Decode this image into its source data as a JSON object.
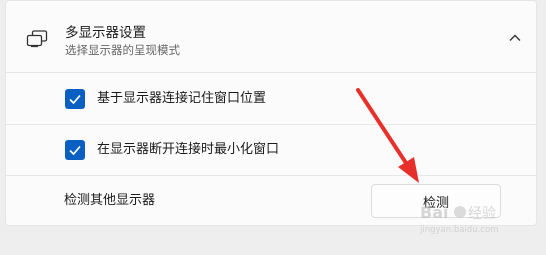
{
  "section": {
    "title": "多显示器设置",
    "subtitle": "选择显示器的呈现模式",
    "icon": "multi-monitor-icon",
    "expand_icon": "chevron-up-icon"
  },
  "options": [
    {
      "label": "基于显示器连接记住窗口位置",
      "checked": true
    },
    {
      "label": "在显示器断开连接时最小化窗口",
      "checked": true
    }
  ],
  "detect": {
    "label": "检测其他显示器",
    "button_label": "检测"
  },
  "annotation": {
    "arrow_color": "#e8302a"
  },
  "watermark": {
    "text": "Baidu 经验",
    "subtext": "jingyan.baidu.com"
  },
  "colors": {
    "accent": "#0a5fc2",
    "arrow": "#e8302a"
  }
}
